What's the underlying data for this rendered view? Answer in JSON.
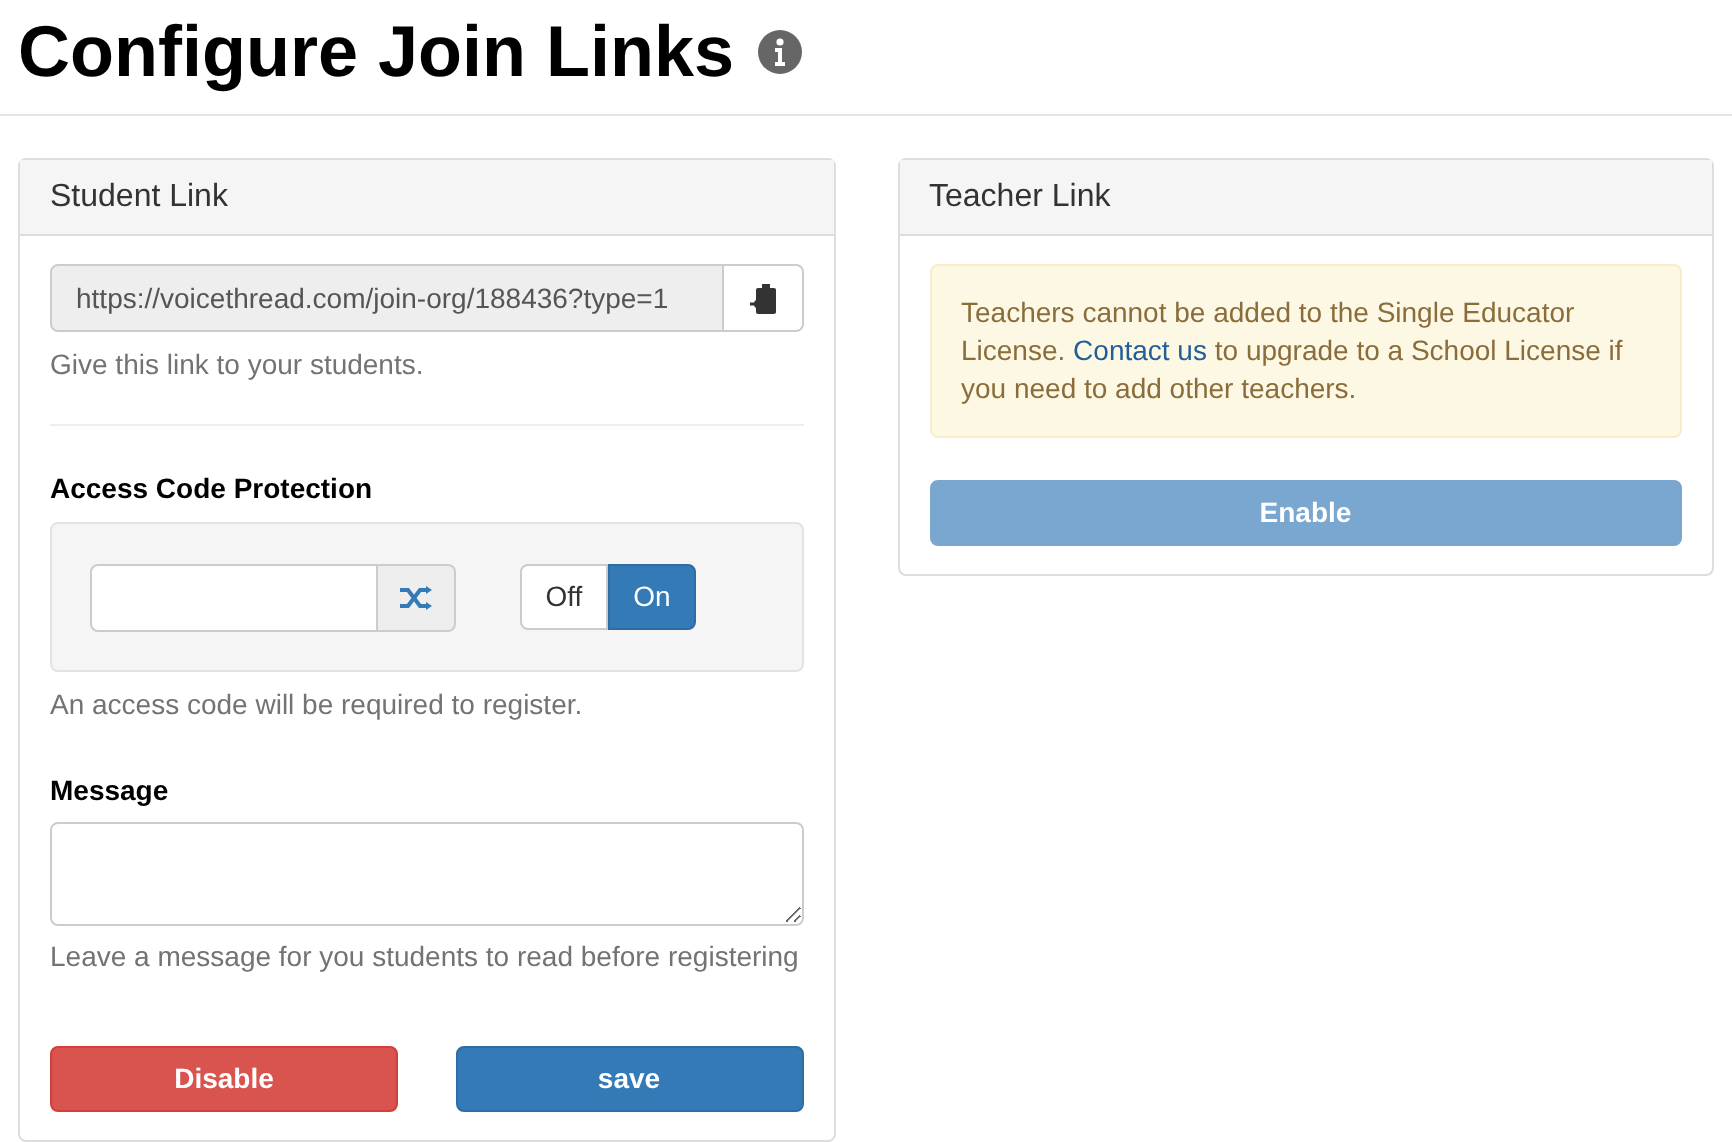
{
  "page_title": "Configure Join Links",
  "student_link": {
    "title": "Student Link",
    "url": "https://voicethread.com/join-org/188436?type=1",
    "url_help": "Give this link to your students.",
    "access_code": {
      "label": "Access Code Protection",
      "toggle": [
        {
          "label": "Off",
          "selected": false
        },
        {
          "label": "On",
          "selected": true
        }
      ],
      "help": "An access code will be required to register."
    },
    "message": {
      "label": "Message",
      "help": "Leave a message for you students to read before registering"
    },
    "buttons": [
      {
        "kind": "danger",
        "label": "Disable"
      },
      {
        "kind": "primary",
        "label": "save"
      }
    ]
  },
  "teacher_link": {
    "title": "Teacher Link",
    "notice": {
      "before": "Teachers cannot be added to the Single Educator License. ",
      "link": "Contact us",
      "after": " to upgrade to a School License if you need to add other teachers."
    },
    "button": {
      "label": "Enable",
      "disabled": true
    }
  }
}
